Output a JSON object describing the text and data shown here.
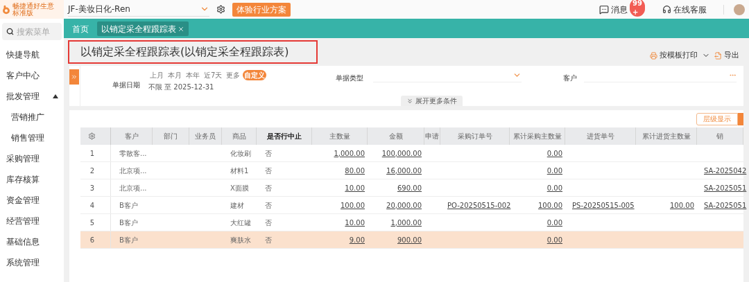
{
  "brand": {
    "name": "畅捷通好生意",
    "edition": "标准版"
  },
  "top_bar": {
    "account": "JF-美妆日化-Ren",
    "promo_button": "体验行业方案",
    "messages": {
      "label": "消息",
      "badge": "99 +"
    },
    "support": "在线客服"
  },
  "sidebar": {
    "search": {
      "placeholder": "搜索菜单"
    },
    "items": [
      {
        "label": "快捷导航"
      },
      {
        "label": "客户中心"
      },
      {
        "label": "批发管理",
        "expanded": true,
        "children": [
          {
            "label": "营销推广"
          },
          {
            "label": "销售管理"
          }
        ]
      },
      {
        "label": "采购管理"
      },
      {
        "label": "库存核算"
      },
      {
        "label": "资金管理"
      },
      {
        "label": "经营管理"
      },
      {
        "label": "基础信息"
      },
      {
        "label": "系统管理"
      }
    ]
  },
  "tabs": [
    {
      "label": "首页",
      "selected": false,
      "closable": false
    },
    {
      "label": "以销定采全程跟踪表",
      "selected": true,
      "closable": true
    }
  ],
  "page": {
    "title": "以销定采全程跟踪表(以销定采全程跟踪表)",
    "actions": [
      "按模板打印",
      "导出"
    ]
  },
  "filters": {
    "date": {
      "label": "单据日期",
      "chips": [
        {
          "label": "上月",
          "selected": false
        },
        {
          "label": "本月",
          "selected": false
        },
        {
          "label": "本年",
          "selected": false
        },
        {
          "label": "近7天",
          "selected": false
        },
        {
          "label": "更多",
          "selected": false
        },
        {
          "label": "自定义",
          "selected": true
        }
      ],
      "range": "不限 至 2025-12-31"
    },
    "doc_type": {
      "label": "单据类型"
    },
    "customer": {
      "label": "客户"
    },
    "expand": "展开更多条件"
  },
  "view_toggle": {
    "label": "层级显示"
  },
  "table": {
    "columns": [
      {
        "label": "客户",
        "kind": "text",
        "emphasized": false
      },
      {
        "label": "部门",
        "kind": "text",
        "emphasized": false
      },
      {
        "label": "业务员",
        "kind": "text",
        "emphasized": false
      },
      {
        "label": "商品",
        "kind": "text",
        "emphasized": false
      },
      {
        "label": "是否行中止",
        "kind": "text",
        "emphasized": true
      },
      {
        "label": "主数量",
        "kind": "number",
        "emphasized": false
      },
      {
        "label": "金额",
        "kind": "number",
        "emphasized": false
      },
      {
        "label": "申请",
        "kind": "number",
        "emphasized": false
      },
      {
        "label": "采购订单号",
        "kind": "code",
        "emphasized": false
      },
      {
        "label": "累计采购主数量",
        "kind": "number",
        "emphasized": false
      },
      {
        "label": "进货单号",
        "kind": "code",
        "emphasized": false
      },
      {
        "label": "累计进货主数量",
        "kind": "number",
        "emphasized": false
      },
      {
        "label": "销",
        "kind": "code",
        "emphasized": false
      }
    ],
    "rows": [
      {
        "index": "1",
        "selected": false,
        "cells": [
          "零散客...",
          "",
          "",
          "化妆刷",
          "否",
          "1,000.00",
          "100,000.00",
          "",
          "",
          "0.00",
          "",
          "",
          ""
        ]
      },
      {
        "index": "2",
        "selected": false,
        "cells": [
          "北京项...",
          "",
          "",
          "材料1",
          "否",
          "80.00",
          "16,000.00",
          "",
          "",
          "0.00",
          "",
          "",
          "SA-2025042"
        ]
      },
      {
        "index": "3",
        "selected": false,
        "cells": [
          "北京项...",
          "",
          "",
          "X面膜",
          "否",
          "10.00",
          "690.00",
          "",
          "",
          "0.00",
          "",
          "",
          "SA-2025051"
        ]
      },
      {
        "index": "4",
        "selected": false,
        "cells": [
          "B客户",
          "",
          "",
          "建材",
          "否",
          "100.00",
          "20,000.00",
          "",
          "PO-20250515-002",
          "100.00",
          "PS-20250515-005",
          "100.00",
          "SA-2025051"
        ]
      },
      {
        "index": "5",
        "selected": false,
        "cells": [
          "B客户",
          "",
          "",
          "大红罐",
          "否",
          "10.00",
          "1,000.00",
          "",
          "",
          "0.00",
          "",
          "",
          ""
        ]
      },
      {
        "index": "6",
        "selected": true,
        "cells": [
          "B客户",
          "",
          "",
          "爽肤水",
          "否",
          "9.00",
          "900.00",
          "",
          "",
          "0.00",
          "",
          "",
          ""
        ]
      }
    ]
  }
}
